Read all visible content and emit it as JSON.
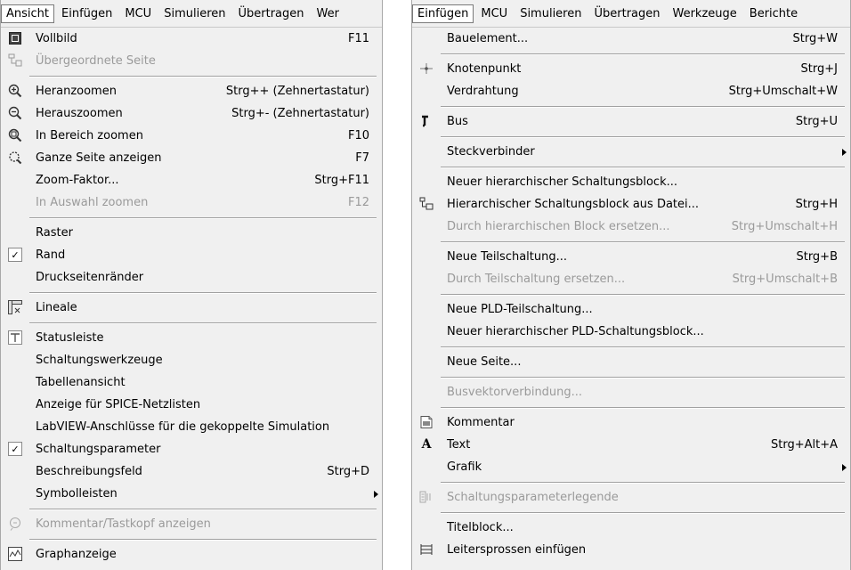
{
  "left": {
    "menubar": [
      "Ansicht",
      "Einfügen",
      "MCU",
      "Simulieren",
      "Übertragen",
      "Wer"
    ],
    "items": [
      {
        "label": "Vollbild",
        "shortcut": "F11"
      },
      {
        "label": "Übergeordnete Seite",
        "shortcut": ""
      },
      {
        "label": "Heranzoomen",
        "shortcut": "Strg++ (Zehnertastatur)"
      },
      {
        "label": "Herauszoomen",
        "shortcut": "Strg+- (Zehnertastatur)"
      },
      {
        "label": "In Bereich zoomen",
        "shortcut": "F10"
      },
      {
        "label": "Ganze Seite anzeigen",
        "shortcut": "F7"
      },
      {
        "label": "Zoom-Faktor...",
        "shortcut": "Strg+F11"
      },
      {
        "label": "In Auswahl zoomen",
        "shortcut": "F12"
      },
      {
        "label": "Raster",
        "shortcut": ""
      },
      {
        "label": "Rand",
        "shortcut": ""
      },
      {
        "label": "Druckseitenränder",
        "shortcut": ""
      },
      {
        "label": "Lineale",
        "shortcut": ""
      },
      {
        "label": "Statusleiste",
        "shortcut": ""
      },
      {
        "label": "Schaltungswerkzeuge",
        "shortcut": ""
      },
      {
        "label": "Tabellenansicht",
        "shortcut": ""
      },
      {
        "label": "Anzeige für SPICE-Netzlisten",
        "shortcut": ""
      },
      {
        "label": "LabVIEW-Anschlüsse für die gekoppelte Simulation",
        "shortcut": ""
      },
      {
        "label": "Schaltungsparameter",
        "shortcut": ""
      },
      {
        "label": "Beschreibungsfeld",
        "shortcut": "Strg+D"
      },
      {
        "label": "Symbolleisten",
        "shortcut": ""
      },
      {
        "label": "Kommentar/Tastkopf anzeigen",
        "shortcut": ""
      },
      {
        "label": "Graphanzeige",
        "shortcut": ""
      }
    ]
  },
  "right": {
    "menubar": [
      "Einfügen",
      "MCU",
      "Simulieren",
      "Übertragen",
      "Werkzeuge",
      "Berichte"
    ],
    "items": [
      {
        "label": "Bauelement...",
        "shortcut": "Strg+W"
      },
      {
        "label": "Knotenpunkt",
        "shortcut": "Strg+J"
      },
      {
        "label": "Verdrahtung",
        "shortcut": "Strg+Umschalt+W"
      },
      {
        "label": "Bus",
        "shortcut": "Strg+U"
      },
      {
        "label": "Steckverbinder",
        "shortcut": ""
      },
      {
        "label": "Neuer hierarchischer Schaltungsblock...",
        "shortcut": ""
      },
      {
        "label": "Hierarchischer Schaltungsblock aus Datei...",
        "shortcut": "Strg+H"
      },
      {
        "label": "Durch hierarchischen Block ersetzen...",
        "shortcut": "Strg+Umschalt+H"
      },
      {
        "label": "Neue Teilschaltung...",
        "shortcut": "Strg+B"
      },
      {
        "label": "Durch Teilschaltung ersetzen...",
        "shortcut": "Strg+Umschalt+B"
      },
      {
        "label": "Neue PLD-Teilschaltung...",
        "shortcut": ""
      },
      {
        "label": "Neuer hierarchischer PLD-Schaltungsblock...",
        "shortcut": ""
      },
      {
        "label": "Neue Seite...",
        "shortcut": ""
      },
      {
        "label": "Busvektorverbindung...",
        "shortcut": ""
      },
      {
        "label": "Kommentar",
        "shortcut": ""
      },
      {
        "label": "Text",
        "shortcut": "Strg+Alt+A"
      },
      {
        "label": "Grafik",
        "shortcut": ""
      },
      {
        "label": "Schaltungsparameterlegende",
        "shortcut": ""
      },
      {
        "label": "Titelblock...",
        "shortcut": ""
      },
      {
        "label": "Leitersprossen einfügen",
        "shortcut": ""
      }
    ]
  }
}
